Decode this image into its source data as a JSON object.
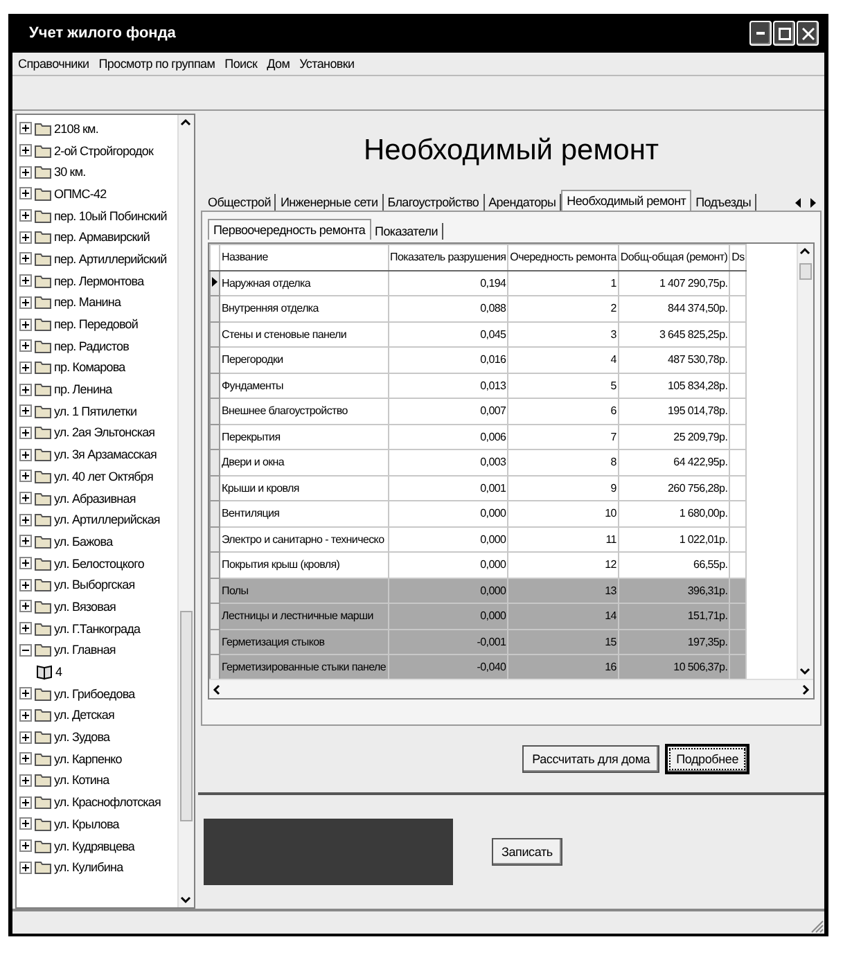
{
  "window": {
    "title": "Учет жилого фонда"
  },
  "menu": [
    "Справочники",
    "Просмотр по группам",
    "Поиск",
    "Дом",
    "Установки"
  ],
  "tree": [
    {
      "label": "2108 км.",
      "expanded": false
    },
    {
      "label": "2-ой Стройгородок",
      "expanded": false
    },
    {
      "label": "30 км.",
      "expanded": false
    },
    {
      "label": "ОПМС-42",
      "expanded": false
    },
    {
      "label": "пер. 10ый Побинский",
      "expanded": false
    },
    {
      "label": "пер. Армавирский",
      "expanded": false
    },
    {
      "label": "пер. Артиллерийский",
      "expanded": false
    },
    {
      "label": "пер. Лермонтова",
      "expanded": false
    },
    {
      "label": "пер. Манина",
      "expanded": false
    },
    {
      "label": "пер. Передовой",
      "expanded": false
    },
    {
      "label": "пер. Радистов",
      "expanded": false
    },
    {
      "label": "пр. Комарова",
      "expanded": false
    },
    {
      "label": "пр. Ленина",
      "expanded": false
    },
    {
      "label": "ул. 1 Пятилетки",
      "expanded": false
    },
    {
      "label": "ул. 2ая Эльтонская",
      "expanded": false
    },
    {
      "label": "ул. 3я Арзамасская",
      "expanded": false
    },
    {
      "label": "ул. 40 лет Октября",
      "expanded": false
    },
    {
      "label": "ул. Абразивная",
      "expanded": false
    },
    {
      "label": "ул. Артиллерийская",
      "expanded": false
    },
    {
      "label": "ул. Бажова",
      "expanded": false
    },
    {
      "label": "ул. Белостоцкого",
      "expanded": false
    },
    {
      "label": "ул. Выборгская",
      "expanded": false
    },
    {
      "label": "ул. Вязовая",
      "expanded": false
    },
    {
      "label": "ул. Г.Танкограда",
      "expanded": false
    },
    {
      "label": "ул. Главная",
      "expanded": true,
      "children": [
        {
          "label": "4"
        }
      ]
    },
    {
      "label": "ул. Грибоедова",
      "expanded": false
    },
    {
      "label": "ул. Детская",
      "expanded": false
    },
    {
      "label": "ул. Зудова",
      "expanded": false
    },
    {
      "label": "ул. Карпенко",
      "expanded": false
    },
    {
      "label": "ул. Котина",
      "expanded": false
    },
    {
      "label": "ул. Краснофлотская",
      "expanded": false
    },
    {
      "label": "ул. Крылова",
      "expanded": false
    },
    {
      "label": "ул. Кудрявцева",
      "expanded": false
    },
    {
      "label": "ул. Кулибина",
      "expanded": false
    }
  ],
  "heading": "Необходимый ремонт",
  "tabs": [
    {
      "label": "Общестрой",
      "selected": false
    },
    {
      "label": "Инженерные сети",
      "selected": false
    },
    {
      "label": "Благоустройство",
      "selected": false
    },
    {
      "label": "Арендаторы",
      "selected": false
    },
    {
      "label": "Необходимый ремонт",
      "selected": true
    },
    {
      "label": "Подъезды",
      "selected": false
    }
  ],
  "subtabs": [
    {
      "label": "Первоочередность ремонта",
      "selected": true
    },
    {
      "label": "Показатели",
      "selected": false
    }
  ],
  "table": {
    "columns": [
      "Название",
      "Показатель разрушения",
      "Очередность ремонта",
      "Dобщ-общая (ремонт)",
      "Ds"
    ],
    "rows": [
      {
        "cells": [
          "Наружная отделка",
          "0,194",
          "1",
          "1 407 290,75р."
        ],
        "current": true,
        "selected": false
      },
      {
        "cells": [
          "Внутренняя отделка",
          "0,088",
          "2",
          "844 374,50р."
        ],
        "current": false,
        "selected": false
      },
      {
        "cells": [
          "Стены и стеновые панели",
          "0,045",
          "3",
          "3 645 825,25р."
        ],
        "current": false,
        "selected": false
      },
      {
        "cells": [
          "Перегородки",
          "0,016",
          "4",
          "487 530,78р."
        ],
        "current": false,
        "selected": false
      },
      {
        "cells": [
          "Фундаменты",
          "0,013",
          "5",
          "105 834,28р."
        ],
        "current": false,
        "selected": false
      },
      {
        "cells": [
          "Внешнее благоустройство",
          "0,007",
          "6",
          "195 014,78р."
        ],
        "current": false,
        "selected": false
      },
      {
        "cells": [
          "Перекрытия",
          "0,006",
          "7",
          "25 209,79р."
        ],
        "current": false,
        "selected": false
      },
      {
        "cells": [
          "Двери и окна",
          "0,003",
          "8",
          "64 422,95р."
        ],
        "current": false,
        "selected": false
      },
      {
        "cells": [
          "Крыши и кровля",
          "0,001",
          "9",
          "260 756,28р."
        ],
        "current": false,
        "selected": false
      },
      {
        "cells": [
          "Вентиляция",
          "0,000",
          "10",
          "1 680,00р."
        ],
        "current": false,
        "selected": false
      },
      {
        "cells": [
          "Электро и санитарно - техническо",
          "0,000",
          "11",
          "1 022,01р."
        ],
        "current": false,
        "selected": false
      },
      {
        "cells": [
          "Покрытия крыш (кровля)",
          "0,000",
          "12",
          "66,55р."
        ],
        "current": false,
        "selected": false
      },
      {
        "cells": [
          "Полы",
          "0,000",
          "13",
          "396,31р."
        ],
        "current": false,
        "selected": true
      },
      {
        "cells": [
          "Лестницы и лестничные марши",
          "0,000",
          "14",
          "151,71р."
        ],
        "current": false,
        "selected": true
      },
      {
        "cells": [
          "Герметизация стыков",
          "-0,001",
          "15",
          "197,35р."
        ],
        "current": false,
        "selected": true
      },
      {
        "cells": [
          "Герметизированные стыки панеле",
          "-0,040",
          "16",
          "10 506,37р."
        ],
        "current": false,
        "selected": true
      }
    ]
  },
  "buttons": [
    {
      "label": "Рассчитать для дома",
      "focused": false
    },
    {
      "label": "Подробнее",
      "focused": true
    }
  ],
  "save_button": "Записать"
}
